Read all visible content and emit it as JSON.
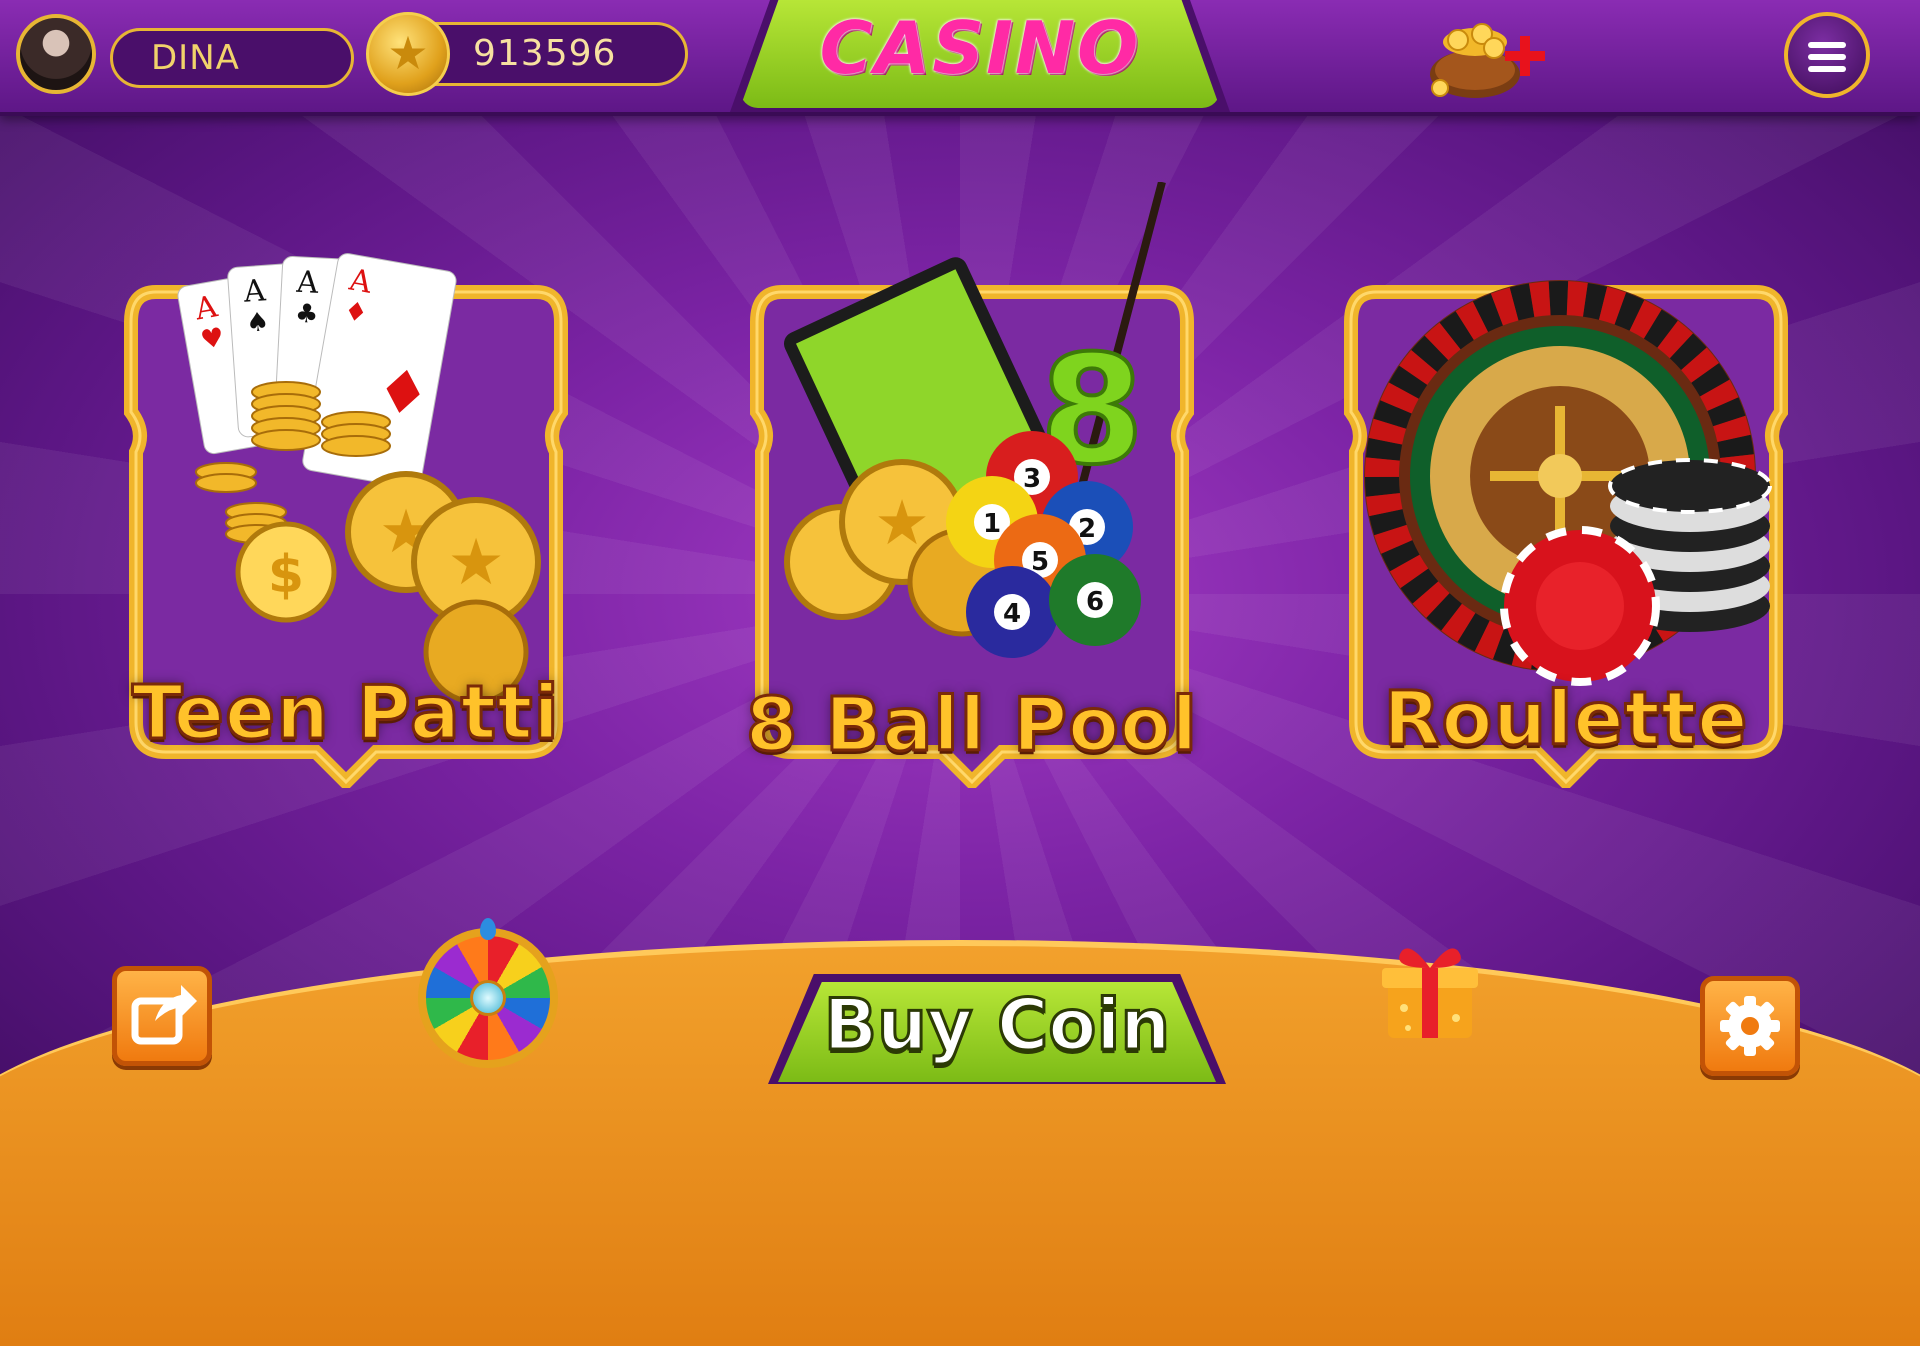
{
  "header": {
    "player_name": "DINA",
    "coin_balance": "913596",
    "title": "CASINO"
  },
  "games": [
    {
      "label": "Teen Patti"
    },
    {
      "label": "8 Ball Pool"
    },
    {
      "label": "Roulette"
    }
  ],
  "footer": {
    "buy_label": "Buy Coin"
  },
  "icons": {
    "avatar": "avatar-icon",
    "coin": "star-coin-icon",
    "bag": "coin-bag-plus-icon",
    "menu": "hamburger-menu-icon",
    "share": "share-icon",
    "wheel": "lucky-wheel-icon",
    "gift": "gift-box-icon",
    "settings": "gear-icon"
  },
  "colors": {
    "background": "#6a1c8c",
    "frame_gold": "#f0b52b",
    "title_pink": "#ff2aa5",
    "banner_green": "#9ad22a",
    "footer_orange": "#f2a12c"
  }
}
